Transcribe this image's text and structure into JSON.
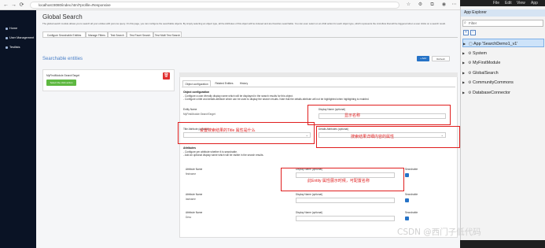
{
  "browser": {
    "url": "localhost:8080/index.html?profile=Responsive"
  },
  "sidebar": {
    "items": [
      {
        "label": "Home"
      },
      {
        "label": "User Management"
      },
      {
        "label": "Testlists"
      }
    ]
  },
  "page": {
    "title": "Global Search",
    "description": "The global search module allows you to search all your entities with just one query. On this page, you can configure the searchable objects. By simply selecting an object type, all the Attributes of this object will be indexed and are therefore searchable. You can even select on an child action for each object type, which represents the microflow that will be triggered when a user clicks on a search result.",
    "tabs": [
      "Configure Searchable Entities",
      "Manage Filters",
      "Test Search",
      "Test Facet Search",
      "Test Multi Test Search"
    ],
    "section_title": "Searchable entities",
    "add_label": "+ Add",
    "refresh_label": "Refresh"
  },
  "entity_card": {
    "name": "MyFirstModule.SearchTarget",
    "select_button": "Select the click action",
    "delete_icon": "trash-icon"
  },
  "detail": {
    "subtabs": [
      "Object configuration",
      "Related Entities",
      "History"
    ],
    "object_config_title": "Object configuration",
    "object_config_line1": "- Configure a user-friendly display name which will be displayed in the search results for this object.",
    "object_config_line2": "- Configure a title and details attribute which can be used to display the search results. Note that the details attribute will not be highlighted when highlighting is enabled.",
    "entity_name_label": "Entity Name",
    "entity_name_value": "MyFirstModule.SearchTarget",
    "display_name_label": "Display Name (optional)",
    "title_attr_label": "Title Attribute (optional)",
    "details_attr_label": "Details Attributes (optional)",
    "attribute_title": "Attributes",
    "attribute_line1": "- Configure per attribute whether it is searchable.",
    "attribute_line2": "- Add an optional display name which will be visible in the search results.",
    "attributes": [
      {
        "label": "Attribute Name",
        "value": "firstname",
        "display_label": "Display Name (optional)",
        "searchable_label": "Searchable"
      },
      {
        "label": "Attribute Name",
        "value": "lastname",
        "display_label": "Display Name (optional)",
        "searchable_label": "Searchable"
      },
      {
        "label": "Attribute Name",
        "value": "Desc",
        "display_label": "Display Name (optional)",
        "searchable_label": "Searchable"
      }
    ]
  },
  "annotations": {
    "display_name": "显示名称",
    "title_attr": "设置搜索结果的Title 属性是什么",
    "details_attr": "搜索结果详细内容的属性",
    "entity_attr": "此Entity 属性展示时候，可配置名称"
  },
  "app_explorer": {
    "menu": [
      "File",
      "Edit",
      "View",
      "App"
    ],
    "title": "App Explorer",
    "filter_placeholder": "Filter",
    "items": [
      {
        "label": "App 'SearchDemo1_v1'"
      },
      {
        "label": "System"
      },
      {
        "label": "MyFirstModule"
      },
      {
        "label": "GlobalSearch"
      },
      {
        "label": "CommunityCommons"
      },
      {
        "label": "DatabaseConnector"
      }
    ]
  },
  "watermark": "CSDN @西门子低代码",
  "colors": {
    "sidebar_bg": "#0a1325",
    "accent_blue": "#4c80c8",
    "select_green": "#5eb841",
    "delete_red": "#e02f2f",
    "annotation_red": "#e01e1e"
  }
}
